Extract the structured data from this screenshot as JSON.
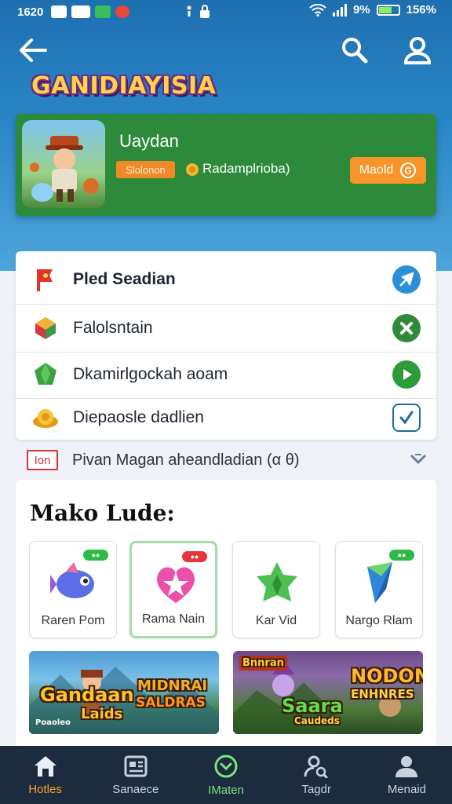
{
  "status_bar": {
    "time": "1620",
    "wifi": "9%",
    "battery": "156%"
  },
  "header": {
    "app_logo": "GANIDIAYISIA"
  },
  "featured": {
    "title": "Uaydan",
    "badge": "Slolonon",
    "meta": "Radamplrioba)",
    "button_label": "Maold"
  },
  "menu": {
    "items": [
      {
        "label": "Pled Seadian",
        "icon": "red-flag-icon",
        "action_icon": "send-icon",
        "action_color": "#2a8fd8"
      },
      {
        "label": "Falolsntain",
        "icon": "gem-cube-icon",
        "action_icon": "close-icon",
        "action_color": "#2f8a3a"
      },
      {
        "label": "Dkamirlgockah aoam",
        "icon": "green-crystal-icon",
        "action_icon": "play-icon",
        "action_color": "#2f9a3a"
      },
      {
        "label": "Diepaosle dadlien",
        "icon": "gold-coin-icon",
        "action_icon": "check-icon",
        "action_color": "#1a6f9e"
      }
    ]
  },
  "notice": {
    "tag": "Ion",
    "text": "Pivan Magan aheandladian (α θ)"
  },
  "section": {
    "title": "Mako Lude:",
    "tiles": [
      {
        "label": "Raren Pom",
        "art": "fish-icon",
        "pill_color": "#2dbb45"
      },
      {
        "label": "Rama Nain",
        "art": "star-heart-icon",
        "pill_color": "#e8343c"
      },
      {
        "label": "Kar Vid",
        "art": "green-leaf-icon",
        "pill_color": ""
      },
      {
        "label": "Nargo Rlam",
        "art": "blue-crystal-icon",
        "pill_color": "#2dbb45"
      }
    ],
    "banners": [
      {
        "line1": "Gandaan",
        "line2": "Laids",
        "line3": "MIDNRAI",
        "line4": "SALDRAS",
        "corner": "Poaoleo"
      },
      {
        "line1": "Bnnran",
        "line2": "Saara",
        "line3": "Caudeds",
        "line4": "NODON",
        "line5": "ENHNRES"
      }
    ]
  },
  "bottom_nav": {
    "items": [
      {
        "label": "Hotles"
      },
      {
        "label": "Sanaece"
      },
      {
        "label": "IMaten"
      },
      {
        "label": "Tagdr"
      },
      {
        "label": "Menaid"
      }
    ]
  }
}
